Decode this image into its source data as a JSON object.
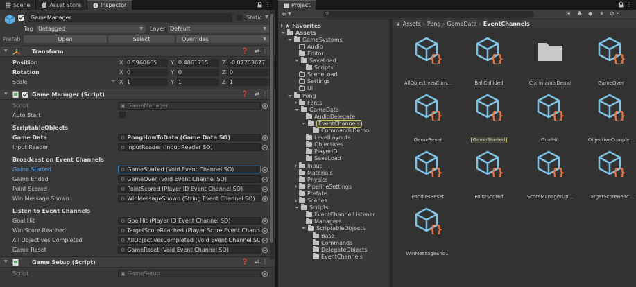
{
  "inspector": {
    "tabs": [
      {
        "label": "Scene",
        "icon": "grid-icon"
      },
      {
        "label": "Asset Store",
        "icon": "bag-icon"
      },
      {
        "label": "Inspector",
        "icon": "info-icon"
      }
    ],
    "gameobject": {
      "name": "GameManager",
      "static_label": "Static",
      "tag_label": "Tag",
      "tag_value": "Untagged",
      "layer_label": "Layer",
      "layer_value": "Default",
      "prefab_label": "Prefab",
      "open_label": "Open",
      "select_label": "Select",
      "overrides_label": "Overrides"
    },
    "transform": {
      "title": "Transform",
      "position_label": "Position",
      "rotation_label": "Rotation",
      "scale_label": "Scale",
      "position": {
        "x": "0.5960665",
        "y": "0.4861715",
        "z": "-0.07753677"
      },
      "rotation": {
        "x": "0",
        "y": "0",
        "z": "0"
      },
      "scale": {
        "x": "1",
        "y": "1",
        "z": "1"
      }
    },
    "script_component": {
      "title": "Game Manager (Script)",
      "script_label": "Script",
      "script_value": "GameManager",
      "auto_start_label": "Auto Start",
      "scriptable_header": "ScriptableObjects",
      "game_data_label": "Game Data",
      "game_data_value": "PongHowToData (Game Data SO)",
      "input_reader_label": "Input Reader",
      "input_reader_value": "InputReader (Input Reader SO)",
      "broadcast_header": "Broadcast on Event Channels",
      "broadcast": [
        {
          "label": "Game Started",
          "value": "GameStarted (Void Event Channel SO)"
        },
        {
          "label": "Game Ended",
          "value": "GameOver (Void Event Channel SO)"
        },
        {
          "label": "Point Scored",
          "value": "PointScored (Player ID Event Channel SO)"
        },
        {
          "label": "Win Message Shown",
          "value": "WinMessageShown (String Event Channel SO)"
        }
      ],
      "listen_header": "Listen to Event Channels",
      "listen": [
        {
          "label": "Goal Hit",
          "value": "GoalHit (Player ID Event Channel SO)"
        },
        {
          "label": "Win Score Reached",
          "value": "TargetScoreReached (Player Score Event Channel S"
        },
        {
          "label": "All Objectives Completed",
          "value": "AllObjectivesCompleted (Void Event Channel SO)"
        },
        {
          "label": "Game Reset",
          "value": "GameReset (Void Event Channel SO)"
        }
      ]
    },
    "setup_component": {
      "title": "Game Setup (Script)",
      "script_label": "Script",
      "script_value": "GameSetup"
    }
  },
  "project": {
    "tab_label": "Project",
    "add_label": "+",
    "breadcrumb": [
      "Assets",
      "Pong",
      "GameData",
      "EventChannels"
    ],
    "hidden_count": "9",
    "tree": [
      {
        "label": "Favorites",
        "depth": 0,
        "arrow": "right",
        "icon": "star"
      },
      {
        "label": "Assets",
        "depth": 0,
        "arrow": "down",
        "icon": "folder"
      },
      {
        "label": "GameSystems",
        "depth": 1,
        "arrow": "down",
        "icon": "folder"
      },
      {
        "label": "Audio",
        "depth": 2,
        "arrow": "",
        "icon": "empty"
      },
      {
        "label": "Editor",
        "depth": 2,
        "arrow": "",
        "icon": "folder"
      },
      {
        "label": "SaveLoad",
        "depth": 2,
        "arrow": "down",
        "icon": "folder"
      },
      {
        "label": "Scripts",
        "depth": 3,
        "arrow": "",
        "icon": "folder"
      },
      {
        "label": "SceneLoad",
        "depth": 2,
        "arrow": "",
        "icon": "empty"
      },
      {
        "label": "Settings",
        "depth": 2,
        "arrow": "",
        "icon": "empty"
      },
      {
        "label": "UI",
        "depth": 2,
        "arrow": "",
        "icon": "empty"
      },
      {
        "label": "Pong",
        "depth": 1,
        "arrow": "down",
        "icon": "folder"
      },
      {
        "label": "Fonts",
        "depth": 2,
        "arrow": "right",
        "icon": "folder"
      },
      {
        "label": "GameData",
        "depth": 2,
        "arrow": "down",
        "icon": "folder"
      },
      {
        "label": "AudioDelegate",
        "depth": 3,
        "arrow": "",
        "icon": "folder"
      },
      {
        "label": "EventChannels",
        "depth": 3,
        "arrow": "down",
        "icon": "folder",
        "selected": true
      },
      {
        "label": "CommandsDemo",
        "depth": 4,
        "arrow": "",
        "icon": "folder"
      },
      {
        "label": "LevelLayouts",
        "depth": 3,
        "arrow": "",
        "icon": "folder"
      },
      {
        "label": "Objectives",
        "depth": 3,
        "arrow": "",
        "icon": "folder"
      },
      {
        "label": "PlayerID",
        "depth": 3,
        "arrow": "",
        "icon": "folder"
      },
      {
        "label": "SaveLoad",
        "depth": 3,
        "arrow": "",
        "icon": "folder"
      },
      {
        "label": "Input",
        "depth": 2,
        "arrow": "right",
        "icon": "folder"
      },
      {
        "label": "Materials",
        "depth": 2,
        "arrow": "",
        "icon": "folder"
      },
      {
        "label": "Physics",
        "depth": 2,
        "arrow": "",
        "icon": "folder"
      },
      {
        "label": "PipelineSettings",
        "depth": 2,
        "arrow": "right",
        "icon": "folder"
      },
      {
        "label": "Prefabs",
        "depth": 2,
        "arrow": "",
        "icon": "folder"
      },
      {
        "label": "Scenes",
        "depth": 2,
        "arrow": "right",
        "icon": "folder"
      },
      {
        "label": "Scripts",
        "depth": 2,
        "arrow": "down",
        "icon": "folder"
      },
      {
        "label": "EventChannelListener",
        "depth": 3,
        "arrow": "",
        "icon": "folder"
      },
      {
        "label": "Managers",
        "depth": 3,
        "arrow": "",
        "icon": "folder"
      },
      {
        "label": "ScriptableObjects",
        "depth": 3,
        "arrow": "down",
        "icon": "folder"
      },
      {
        "label": "Base",
        "depth": 4,
        "arrow": "",
        "icon": "folder"
      },
      {
        "label": "Commands",
        "depth": 4,
        "arrow": "",
        "icon": "folder"
      },
      {
        "label": "DelegateObjects",
        "depth": 4,
        "arrow": "",
        "icon": "folder"
      },
      {
        "label": "EventChannels",
        "depth": 4,
        "arrow": "",
        "icon": "folder"
      }
    ],
    "assets": [
      {
        "label": "AllObjectivesCom...",
        "kind": "so"
      },
      {
        "label": "BallCollided",
        "kind": "so"
      },
      {
        "label": "CommandsDemo",
        "kind": "folder"
      },
      {
        "label": "GameOver",
        "kind": "so"
      },
      {
        "label": "GameReset",
        "kind": "so"
      },
      {
        "label": "GameStarted",
        "kind": "so",
        "selected": true
      },
      {
        "label": "GoalHit",
        "kind": "so"
      },
      {
        "label": "ObjectiveComple...",
        "kind": "so"
      },
      {
        "label": "PaddlesReset",
        "kind": "so"
      },
      {
        "label": "PointScored",
        "kind": "so"
      },
      {
        "label": "ScoreManagerUp...",
        "kind": "so"
      },
      {
        "label": "TargetScoreReac...",
        "kind": "so"
      },
      {
        "label": "WinMessageSho...",
        "kind": "so"
      }
    ],
    "colors": {
      "so_cube": "#7fc3e6",
      "so_braces": "#f4763f",
      "selection": "#c8c25a"
    }
  }
}
